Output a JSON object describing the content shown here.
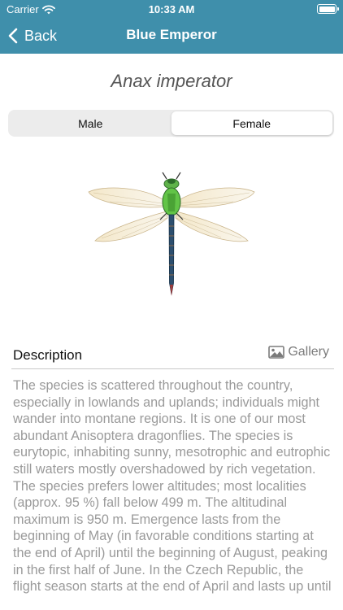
{
  "status_bar": {
    "carrier": "Carrier",
    "time": "10:33 AM",
    "icons": [
      "wifi-icon",
      "battery-icon"
    ]
  },
  "nav": {
    "back_label": "Back",
    "title": "Blue Emperor",
    "color": "#3f8fab"
  },
  "species": {
    "latin_name": "Anax imperator"
  },
  "segments": {
    "items": [
      "Male",
      "Female"
    ],
    "selected": "Female"
  },
  "description": {
    "heading": "Description",
    "gallery_label": "Gallery",
    "text": "The species is scattered throughout the country, especially in lowlands and uplands; individuals might wander into montane regions. It is one of our most abundant Anisoptera dragonflies. The species is eurytopic, inhabiting sunny, mesotrophic and eutrophic still waters mostly overshadowed by rich vegetation. The species prefers lower altitudes; most localities (approx. 95 %) fall below 499 m. The altitudinal maximum is 950 m. Emergence lasts from the beginning of May (in favorable conditions starting at the end of April) until the beginning of August, peaking in the first half of June. In the Czech Republic, the flight season starts at the end of April and lasts up until"
  }
}
